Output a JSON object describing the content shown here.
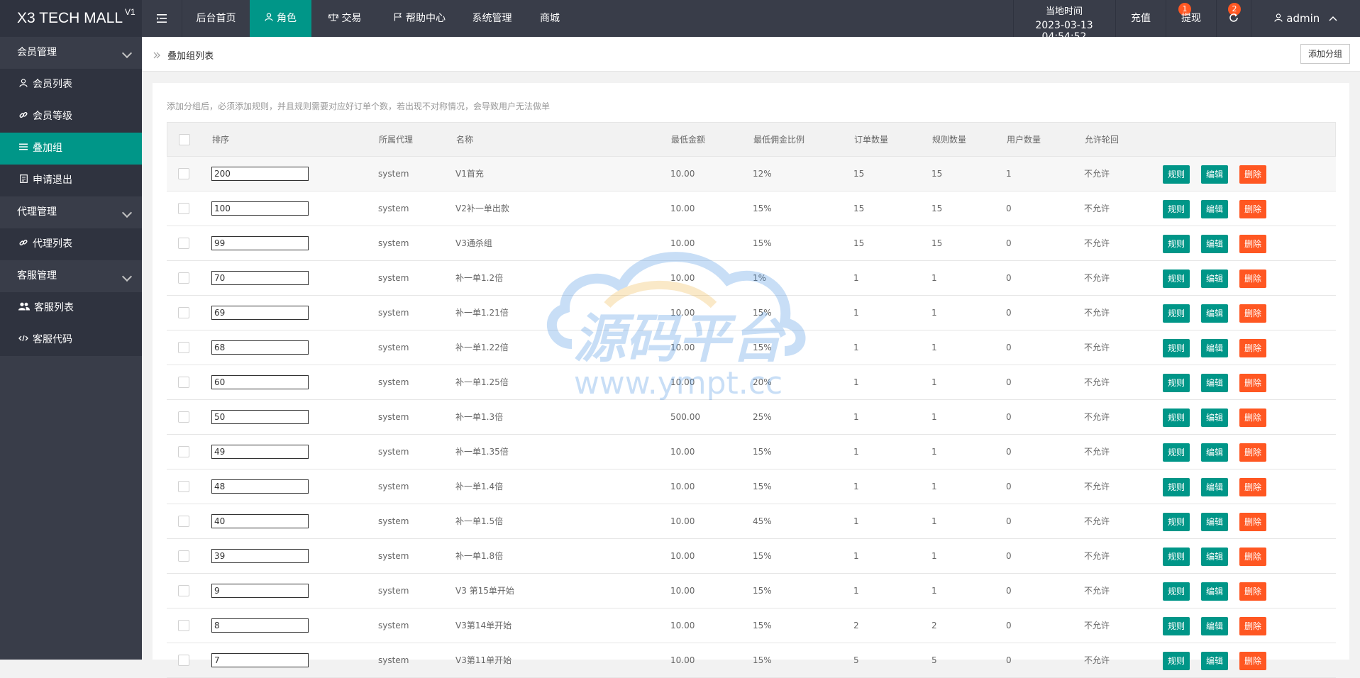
{
  "app": {
    "logo_text": "X3 TECH MALL",
    "logo_version": "V1"
  },
  "topnav": {
    "menu_toggle_icon": "menu-fold-icon",
    "items": [
      {
        "label": "后台首页",
        "icon": ""
      },
      {
        "label": "角色",
        "icon": "user-icon"
      },
      {
        "label": "交易",
        "icon": "scale-icon"
      },
      {
        "label": "帮助中心",
        "icon": "flag-icon"
      },
      {
        "label": "系统管理",
        "icon": ""
      },
      {
        "label": "商城",
        "icon": ""
      }
    ],
    "time_label": "当地时间",
    "time_value": "2023-03-13 04:54:52",
    "recharge_label": "充值",
    "recharge_badge": "1",
    "withdraw_label": "提现",
    "withdraw_badge": "2",
    "refresh_icon": "refresh-icon",
    "user_label": "admin",
    "accent_color": "#009688",
    "danger_color": "#ff5722"
  },
  "sidebar": {
    "groups": [
      {
        "label": "会员管理",
        "items": [
          {
            "label": "会员列表",
            "icon": "user-icon"
          },
          {
            "label": "会员等级",
            "icon": "link-icon"
          },
          {
            "label": "叠加组",
            "icon": "list-icon",
            "active": true
          },
          {
            "label": "申请退出",
            "icon": "document-icon"
          }
        ]
      },
      {
        "label": "代理管理",
        "items": [
          {
            "label": "代理列表",
            "icon": "link-icon"
          }
        ]
      },
      {
        "label": "客服管理",
        "items": [
          {
            "label": "客服列表",
            "icon": "users-icon"
          },
          {
            "label": "客服代码",
            "icon": "code-icon"
          }
        ]
      }
    ]
  },
  "breadcrumb": {
    "label": "叠加组列表",
    "add_button": "添加分组"
  },
  "main": {
    "hint": "添加分组后，必须添加规则，并且规则需要对应好订单个数，若出现不对称情况，会导致用户无法做单",
    "columns": [
      "排序",
      "所属代理",
      "名称",
      "最低金额",
      "最低佣金比例",
      "订单数量",
      "规则数量",
      "用户数量",
      "允许轮回"
    ],
    "action_labels": {
      "rule": "规则",
      "edit": "编辑",
      "delete": "删除"
    },
    "rows": [
      {
        "sort": "200",
        "agent": "system",
        "name": "V1首充",
        "min_amount": "10.00",
        "min_rate": "12%",
        "orders": "15",
        "rules": "15",
        "users": "1",
        "cycle": "不允许"
      },
      {
        "sort": "100",
        "agent": "system",
        "name": "V2补一单出款",
        "min_amount": "10.00",
        "min_rate": "15%",
        "orders": "15",
        "rules": "15",
        "users": "0",
        "cycle": "不允许"
      },
      {
        "sort": "99",
        "agent": "system",
        "name": "V3通杀组",
        "min_amount": "10.00",
        "min_rate": "15%",
        "orders": "15",
        "rules": "15",
        "users": "0",
        "cycle": "不允许"
      },
      {
        "sort": "70",
        "agent": "system",
        "name": "补一单1.2倍",
        "min_amount": "10.00",
        "min_rate": "1%",
        "orders": "1",
        "rules": "1",
        "users": "0",
        "cycle": "不允许"
      },
      {
        "sort": "69",
        "agent": "system",
        "name": "补一单1.21倍",
        "min_amount": "10.00",
        "min_rate": "15%",
        "orders": "1",
        "rules": "1",
        "users": "0",
        "cycle": "不允许"
      },
      {
        "sort": "68",
        "agent": "system",
        "name": "补一单1.22倍",
        "min_amount": "10.00",
        "min_rate": "15%",
        "orders": "1",
        "rules": "1",
        "users": "0",
        "cycle": "不允许"
      },
      {
        "sort": "60",
        "agent": "system",
        "name": "补一单1.25倍",
        "min_amount": "10.00",
        "min_rate": "20%",
        "orders": "1",
        "rules": "1",
        "users": "0",
        "cycle": "不允许"
      },
      {
        "sort": "50",
        "agent": "system",
        "name": "补一单1.3倍",
        "min_amount": "500.00",
        "min_rate": "25%",
        "orders": "1",
        "rules": "1",
        "users": "0",
        "cycle": "不允许"
      },
      {
        "sort": "49",
        "agent": "system",
        "name": "补一单1.35倍",
        "min_amount": "10.00",
        "min_rate": "15%",
        "orders": "1",
        "rules": "1",
        "users": "0",
        "cycle": "不允许"
      },
      {
        "sort": "48",
        "agent": "system",
        "name": "补一单1.4倍",
        "min_amount": "10.00",
        "min_rate": "15%",
        "orders": "1",
        "rules": "1",
        "users": "0",
        "cycle": "不允许"
      },
      {
        "sort": "40",
        "agent": "system",
        "name": "补一单1.5倍",
        "min_amount": "10.00",
        "min_rate": "45%",
        "orders": "1",
        "rules": "1",
        "users": "0",
        "cycle": "不允许"
      },
      {
        "sort": "39",
        "agent": "system",
        "name": "补一单1.8倍",
        "min_amount": "10.00",
        "min_rate": "15%",
        "orders": "1",
        "rules": "1",
        "users": "0",
        "cycle": "不允许"
      },
      {
        "sort": "9",
        "agent": "system",
        "name": "V3 第15单开始",
        "min_amount": "10.00",
        "min_rate": "15%",
        "orders": "1",
        "rules": "1",
        "users": "0",
        "cycle": "不允许"
      },
      {
        "sort": "8",
        "agent": "system",
        "name": "V3第14单开始",
        "min_amount": "10.00",
        "min_rate": "15%",
        "orders": "2",
        "rules": "2",
        "users": "0",
        "cycle": "不允许"
      },
      {
        "sort": "7",
        "agent": "system",
        "name": "V3第11单开始",
        "min_amount": "10.00",
        "min_rate": "15%",
        "orders": "5",
        "rules": "5",
        "users": "0",
        "cycle": "不允许"
      }
    ]
  },
  "watermark": {
    "text_cn": "源码平台",
    "text_url": "www.ympt.cc"
  }
}
